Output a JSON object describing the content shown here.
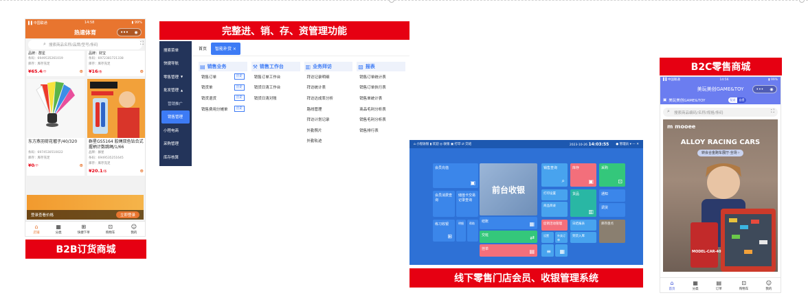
{
  "b2b": {
    "status_left": "▌▌中国联通 ",
    "status_time": "14:58",
    "status_right": "▮ 99%",
    "title": "热速体育",
    "search_placeholder": "搜索商品名称/品牌/型号/条码",
    "products": [
      {
        "name": "东方燕羽荷花毽子/40/320",
        "meta1": "条码：6974530510022",
        "meta2": "库存：库存充足",
        "price": "¥0",
        "unit": "/个"
      },
      {
        "name": "群星GS5164 胶绳双色钻合式握柄计数跳绳/1/66",
        "meta1": "品牌：群星",
        "meta2": "条码：6949535251645",
        "meta3": "库存：库存充足",
        "price": "¥20.1",
        "unit": "/条"
      }
    ],
    "top_products": [
      {
        "name": "品牌：群星",
        "meta1": "条码：6949535261019",
        "meta2": "库存：库存充足",
        "price": "¥65.4",
        "unit": "/个"
      },
      {
        "name": "品牌：财宝",
        "meta1": "条码：6972381721338",
        "meta2": "库存：库存充足",
        "price": "¥16",
        "unit": "/条"
      }
    ],
    "login_hint": "登录查看价格",
    "login_button": "立即登录",
    "tabs": [
      "店铺",
      "分类",
      "快捷下单",
      "购物车",
      "我的"
    ]
  },
  "labels": {
    "b2b": "B2B订货商城",
    "erp": "完整进、销、存、资管理功能",
    "b2c": "B2C零售商城",
    "pos": "线下零售门店会员、收银管理系统"
  },
  "erp": {
    "sidebar": [
      "搜索菜单",
      "快捷导航",
      "零售管理",
      "批发管理",
      "营销推广",
      "销售管理",
      "小程电商",
      "采购管理",
      "库存核算"
    ],
    "tabs": [
      "首页",
      "智能补货 ×"
    ],
    "columns": [
      {
        "title": "销售业务",
        "icon": "📄",
        "items": [
          {
            "label": "销售订单",
            "tag": "历史"
          },
          {
            "label": "销货单",
            "tag": "历史"
          },
          {
            "label": "销货退货",
            "tag": "历史"
          },
          {
            "label": "销售费用分摊单",
            "tag": "历史"
          }
        ]
      },
      {
        "title": "销售工作台",
        "icon": "🔧",
        "items": [
          {
            "label": "销售订单工作台",
            "tag": ""
          },
          {
            "label": "销货日清工作台",
            "tag": ""
          },
          {
            "label": "销货日清对账",
            "tag": ""
          }
        ]
      },
      {
        "title": "业务拜访",
        "icon": "📊",
        "items": [
          {
            "label": "拜访记录明细",
            "tag": ""
          },
          {
            "label": "拜访统计表",
            "tag": ""
          },
          {
            "label": "拜访达成率分析",
            "tag": ""
          },
          {
            "label": "路线管理",
            "tag": ""
          },
          {
            "label": "拜访计划记录",
            "tag": ""
          },
          {
            "label": "外勤照片",
            "tag": ""
          },
          {
            "label": "外勤轨迹",
            "tag": ""
          }
        ]
      },
      {
        "title": "报表",
        "icon": "📈",
        "items": [
          {
            "label": "销售订单统计表",
            "tag": ""
          },
          {
            "label": "销售订单执行表",
            "tag": ""
          },
          {
            "label": "销售单统计表",
            "tag": ""
          },
          {
            "label": "商品毛利分析表",
            "tag": ""
          },
          {
            "label": "销售毛利分析表",
            "tag": ""
          },
          {
            "label": "销售排行表",
            "tag": ""
          }
        ]
      }
    ]
  },
  "pos": {
    "bar_left": "⌂ 小程收银   ▮ 欢迎   ◎ 收银   ▣ 打印   ⇄ 交班",
    "bar_date": "2023-10-26",
    "bar_time": "14:03:55",
    "bar_right": "● 管理员 ▾   —   ✕",
    "tiles": {
      "member_recharge": "会员充值",
      "member_consume": "会员消费查询",
      "card_points": "储值卡交易记录查询",
      "practice": "练习收银",
      "main": "前台收银",
      "sales_query": "销售查询",
      "stock": "库存",
      "purchase": "采购",
      "unit": "单位",
      "prints": "打印设置",
      "product_list": "商品目录",
      "checkout": "结账",
      "goods": "货品",
      "notice": "通知",
      "inbound": "调货",
      "exchange": "交班",
      "settle": "挂单",
      "promo": "促销活动管理",
      "report": "日结报表",
      "stock_check": "库存盘点",
      "shortcut": "设置",
      "detail": "明细",
      "print": "外卖订单",
      "goods_in": "到货入库",
      "help": "帮助"
    }
  },
  "b2c": {
    "status_left": "▌▌中国联通",
    "status_time": "14:56",
    "status_right": "▮ 99%",
    "title": "美玩美创GAME&TOY",
    "store_name": "美玩美创GAME&TOY",
    "toggle_a": "配送",
    "toggle_b": "自提",
    "search_placeholder": "搜索商品编码/名称/规格/条码",
    "banner_logo": "m mooee",
    "banner_title": "ALLOY RACING CARS",
    "banner_pill": "转会合金跑车展厅·全场 ›",
    "box_text": "MODEL-CAR-40",
    "tabs": [
      "首页",
      "分类",
      "订单",
      "购物车",
      "我的"
    ]
  },
  "colors": {
    "accent_red": "#e60012",
    "b2b_orange": "#e8752f",
    "erp_navy": "#23345a",
    "pos_blue": "#2e71d6",
    "b2c_purple": "#6b7df0"
  }
}
